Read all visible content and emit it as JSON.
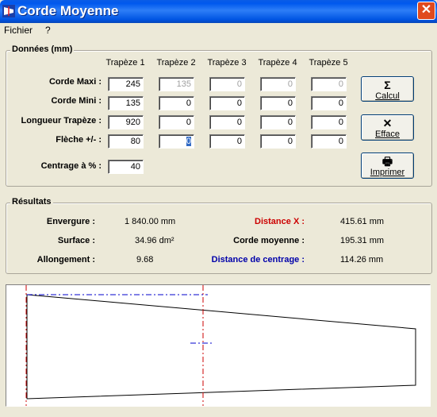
{
  "window": {
    "title": "Corde Moyenne",
    "close_glyph": "✕"
  },
  "menu": {
    "items": [
      "Fichier",
      "?"
    ]
  },
  "donnees": {
    "label": "Données (mm)",
    "columns": [
      "Trapèze 1",
      "Trapèze 2",
      "Trapèze 3",
      "Trapèze 4",
      "Trapèze 5"
    ],
    "rows": [
      {
        "label": "Corde Maxi :",
        "values": [
          "245",
          "135",
          "0",
          "0",
          "0"
        ]
      },
      {
        "label": "Corde Mini :",
        "values": [
          "135",
          "0",
          "0",
          "0",
          "0"
        ]
      },
      {
        "label": "Longueur Trapèze :",
        "values": [
          "920",
          "0",
          "0",
          "0",
          "0"
        ]
      },
      {
        "label": "Flèche  +/- :",
        "values": [
          "80",
          "0",
          "0",
          "0",
          "0"
        ]
      }
    ],
    "centrage_label": "Centrage à  % :",
    "centrage_value": "40"
  },
  "buttons": {
    "calcul": {
      "icon": "Σ",
      "label": "Calcul"
    },
    "efface": {
      "icon": "✕",
      "label": "Efface"
    },
    "imprimer": {
      "icon": "🖶",
      "label": "Imprimer"
    }
  },
  "resultats": {
    "label": "Résultats",
    "envergure_label": "Envergure :",
    "envergure_value": "1 840.00 mm",
    "surface_label": "Surface :",
    "surface_value": "34.96 dm²",
    "allongement_label": "Allongement :",
    "allongement_value": "9.68",
    "distance_x_label": "Distance X :",
    "distance_x_value": "415.61 mm",
    "corde_moyenne_label": "Corde moyenne :",
    "corde_moyenne_value": "195.31 mm",
    "distance_centrage_label": "Distance de centrage :",
    "distance_centrage_value": "114.26 mm"
  },
  "colors": {
    "distance_x": "#CC0000",
    "distance_centrage": "#0000AA",
    "axis_red": "#CC0000",
    "axis_blue": "#0000CC"
  },
  "icons": {
    "app": "app-icon",
    "calcul": "sigma-icon",
    "efface": "erase-x-icon",
    "imprimer": "printer-icon"
  }
}
